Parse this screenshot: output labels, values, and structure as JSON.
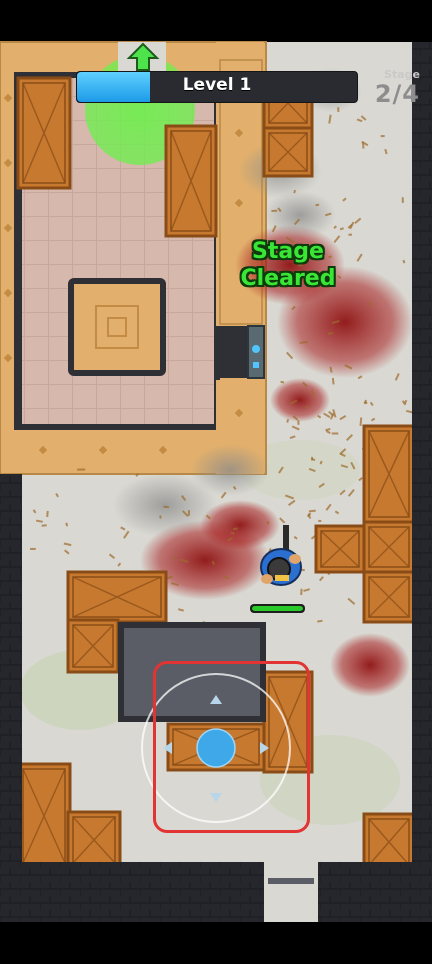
{
  "hud": {
    "level_label": "Level 1",
    "stage_label": "Stage",
    "stage_progress": "2/4",
    "xp_fraction": 0.26
  },
  "banner": {
    "line1": "Stage",
    "line2": "Cleared"
  },
  "player": {
    "health_fraction": 1.0
  },
  "colors": {
    "floor": "#d9d8d2",
    "room_floor": "#d7b8ac",
    "wall": "#2f3036",
    "crate": "#c77a2f",
    "crate_dark": "#8a4c17",
    "trim": "#e0b070",
    "blood": "#9a1d1d",
    "accent_blue": "#1c9be8",
    "health_green": "#29c929",
    "highlight_red": "#e33434",
    "exit_arrow_green": "#4ee34c"
  },
  "icons": [
    "exit-arrow-icon",
    "door-panel-icon",
    "joystick-up-icon",
    "joystick-down-icon",
    "joystick-left-icon",
    "joystick-right-icon"
  ]
}
